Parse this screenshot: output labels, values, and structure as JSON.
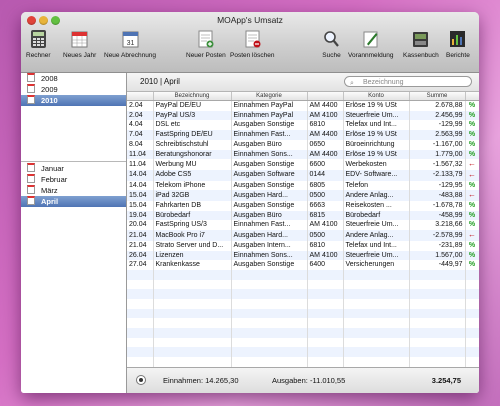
{
  "window": {
    "title": "MOApp's Umsatz"
  },
  "toolbar": {
    "rechner": "Rechner",
    "neues_jahr": "Neues Jahr",
    "neue_abrechnung": "Neue Abrechnung",
    "neuer_posten": "Neuer Posten",
    "posten_loeschen": "Posten löschen",
    "suche": "Suche",
    "vorannmeldung": "Vorannmeldung",
    "kassenbuch": "Kassenbuch",
    "berichte": "Berichte"
  },
  "sidebar": {
    "years": [
      "2008",
      "2009",
      "2010"
    ],
    "selected_year": "2010",
    "months": [
      "Januar",
      "Februar",
      "März",
      "April"
    ],
    "selected_month": "April"
  },
  "header": {
    "breadcrumb": "2010 | April",
    "search_placeholder": "Bezeichnung"
  },
  "table": {
    "columns": [
      "",
      "Bezeichnung",
      "Kategorie",
      "",
      "Konto",
      "Summe",
      ""
    ],
    "rows": [
      {
        "date": "2.04",
        "name": "PayPal DE/EU",
        "category": "Einnahmen PayPal",
        "code": "AM 4400",
        "account": "Erlöse 19 % USt",
        "sum": "2.678,88",
        "flag": "%"
      },
      {
        "date": "2.04",
        "name": "PayPal US/3",
        "category": "Einnahmen PayPal",
        "code": "AM 4100",
        "account": "Steuerfreie Um...",
        "sum": "2.456,99",
        "flag": "%"
      },
      {
        "date": "4.04",
        "name": "DSL etc",
        "category": "Ausgaben Sonstige",
        "code": "6810",
        "account": "Telefax und Int...",
        "sum": "-129,99",
        "flag": "%"
      },
      {
        "date": "7.04",
        "name": "FastSpring DE/EU",
        "category": "Einnahmen Fast...",
        "code": "AM 4400",
        "account": "Erlöse 19 % USt",
        "sum": "2.563,99",
        "flag": "%"
      },
      {
        "date": "8.04",
        "name": "Schreibtischstuhl",
        "category": "Ausgaben Büro",
        "code": "0650",
        "account": "Büroeinrichtung",
        "sum": "-1.167,00",
        "flag": "%"
      },
      {
        "date": "11.04",
        "name": "Beratungshonorar",
        "category": "Einnahmen Sons...",
        "code": "AM 4400",
        "account": "Erlöse 19 % USt",
        "sum": "1.779,00",
        "flag": "%"
      },
      {
        "date": "11.04",
        "name": "Werbung MU",
        "category": "Ausgaben Sonstige",
        "code": "6600",
        "account": "Werbekosten",
        "sum": "-1.567,32",
        "flag": "←"
      },
      {
        "date": "14.04",
        "name": "Adobe CS5",
        "category": "Ausgaben Software",
        "code": "0144",
        "account": "EDV- Software...",
        "sum": "-2.133,79",
        "flag": "←"
      },
      {
        "date": "14.04",
        "name": "Telekom iPhone",
        "category": "Ausgaben Sonstige",
        "code": "6805",
        "account": "Telefon",
        "sum": "-129,95",
        "flag": "%"
      },
      {
        "date": "15.04",
        "name": "iPad 32GB",
        "category": "Ausgaben Hard...",
        "code": "0500",
        "account": "Andere Anlag...",
        "sum": "-483,88",
        "flag": "←"
      },
      {
        "date": "15.04",
        "name": "Fahrkarten DB",
        "category": "Ausgaben Sonstige",
        "code": "6663",
        "account": "Reisekosten ...",
        "sum": "-1.678,78",
        "flag": "%"
      },
      {
        "date": "19.04",
        "name": "Bürobedarf",
        "category": "Ausgaben Büro",
        "code": "6815",
        "account": "Bürobedarf",
        "sum": "-458,99",
        "flag": "%"
      },
      {
        "date": "20.04",
        "name": "FastSpring US/3",
        "category": "Einnahmen Fast...",
        "code": "AM 4100",
        "account": "Steuerfreie Um...",
        "sum": "3.218,66",
        "flag": "%"
      },
      {
        "date": "21.04",
        "name": "MacBook Pro i7",
        "category": "Ausgaben Hard...",
        "code": "0500",
        "account": "Andere Anlag...",
        "sum": "-2.578,99",
        "flag": "←"
      },
      {
        "date": "21.04",
        "name": "Strato Server und D...",
        "category": "Ausgaben Intern...",
        "code": "6810",
        "account": "Telefax und Int...",
        "sum": "-231,89",
        "flag": "%"
      },
      {
        "date": "26.04",
        "name": "Lizenzen",
        "category": "Einnahmen Sons...",
        "code": "AM 4100",
        "account": "Steuerfreie Um...",
        "sum": "1.567,00",
        "flag": "%"
      },
      {
        "date": "27.04",
        "name": "Krankenkasse",
        "category": "Ausgaben Sonstige",
        "code": "6400",
        "account": "Versicherungen",
        "sum": "-449,97",
        "flag": "%"
      }
    ]
  },
  "footer": {
    "income_label": "Einnahmen:",
    "income_value": "14.265,30",
    "expense_label": "Ausgaben:",
    "expense_value": "-11.010,55",
    "total": "3.254,75"
  },
  "colors": {
    "income_flag": "#1f9d1f",
    "expense_flag": "#c0121a",
    "selection": "#4f74b4"
  }
}
